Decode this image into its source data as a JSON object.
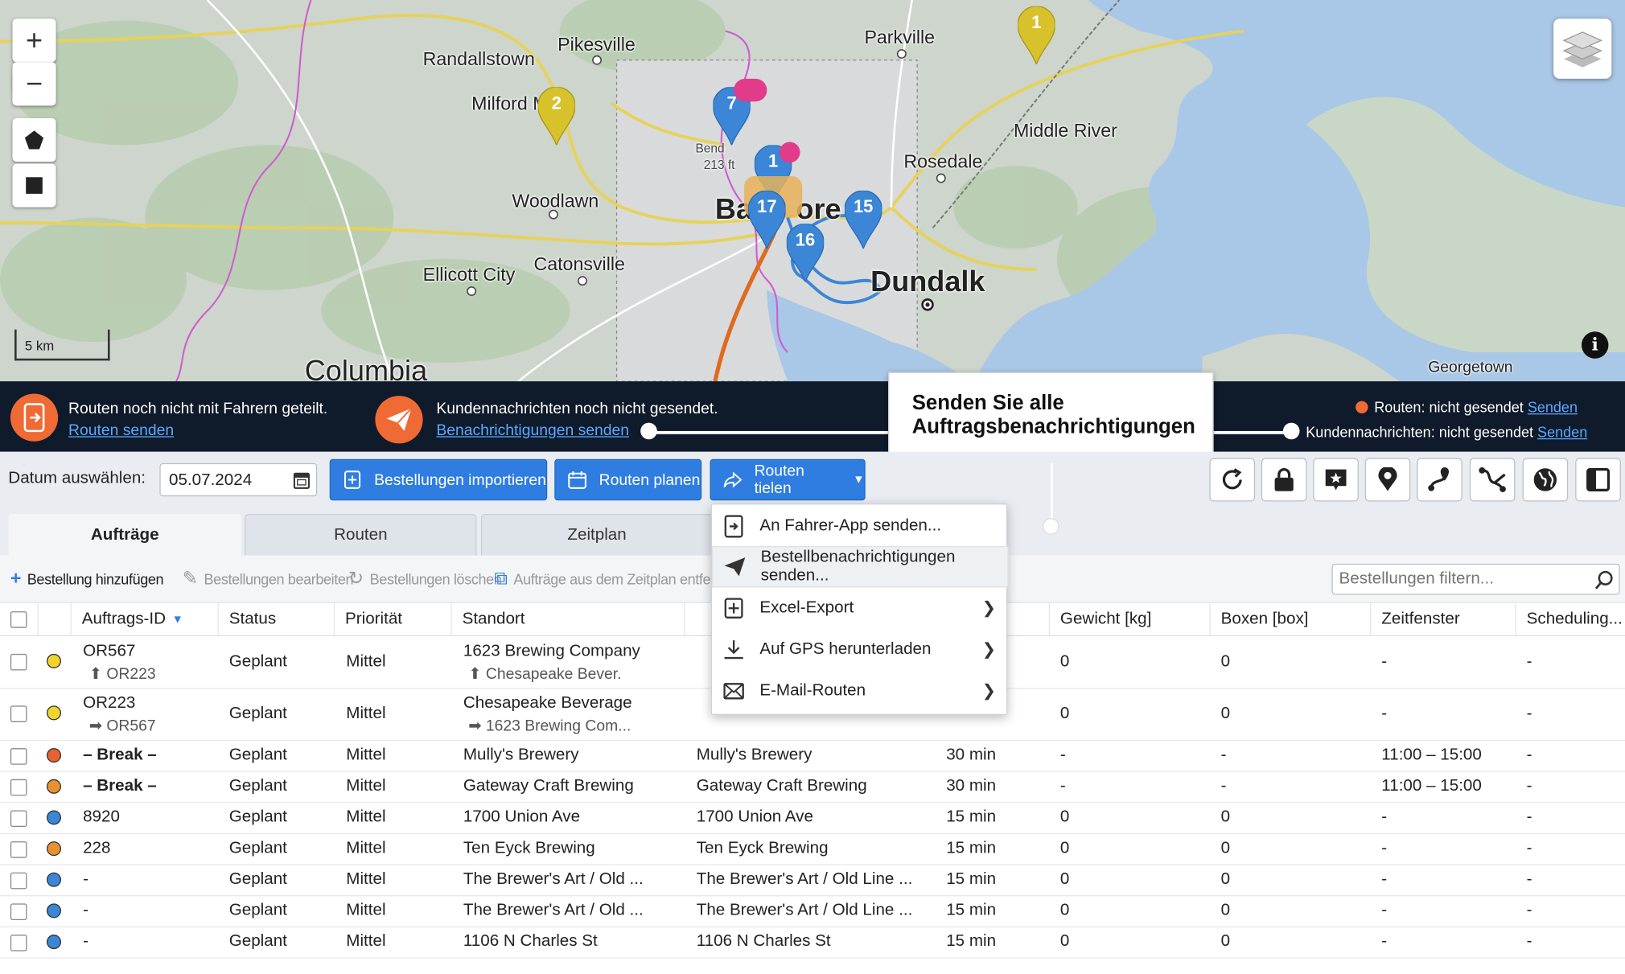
{
  "map": {
    "labels": {
      "randallstown": "Randallstown",
      "pikesville": "Pikesville",
      "parkville": "Parkville",
      "milford": "Milford M",
      "middle_river": "Middle River",
      "rosedale": "Rosedale",
      "woodlawn": "Woodlawn",
      "baltimore_a": "Ba",
      "baltimore_b": "ore",
      "catonsville": "Catonsville",
      "ellicott_city": "Ellicott City",
      "dundalk": "Dundalk",
      "columbia": "Columbia",
      "georgetown": "Georgetown",
      "bend": "Bend",
      "bend_ft": "213 ft"
    },
    "zoom_in": "+",
    "zoom_out": "−",
    "scale": "5 km",
    "info": "i",
    "markers": [
      {
        "label": "1",
        "color": "#d8c22b"
      },
      {
        "label": "2",
        "color": "#d8c22b"
      },
      {
        "label": "7",
        "color": "#3b86d6"
      },
      {
        "label": "1",
        "color": "#3b86d6"
      },
      {
        "label": "17",
        "color": "#3b86d6"
      },
      {
        "label": "16",
        "color": "#3b86d6"
      },
      {
        "label": "15",
        "color": "#3b86d6"
      }
    ]
  },
  "statusbar": {
    "routes_msg": "Routen noch nicht mit Fahrern geteilt.",
    "routes_link": "Routen senden",
    "customer_msg": "Kundennachrichten noch nicht gesendet.",
    "customer_link": "Benachrichtigungen senden",
    "right_routes": "Routen: nicht gesendet",
    "right_routes_link": "Senden",
    "right_customer": "Kundennachrichten: nicht gesendet",
    "right_customer_link": "Senden"
  },
  "callout": {
    "line1": "Senden Sie alle",
    "line2": "Auftragsbenachrichtigungen"
  },
  "toolbar": {
    "date_label": "Datum auswählen:",
    "date_value": "05.07.2024",
    "import_btn": "Bestellungen importieren",
    "plan_btn": "Routen planen",
    "share_btn": "Routen tielen"
  },
  "tabs": [
    "Aufträge",
    "Routen",
    "Zeitplan"
  ],
  "actions": {
    "add": "Bestellung hinzufügen",
    "edit": "Bestellungen bearbeiten",
    "delete": "Bestellungen löschen",
    "remove": "Aufträge aus dem Zeitplan entfernen",
    "filter_placeholder": "Bestellungen filtern..."
  },
  "dropdown": [
    {
      "label": "An Fahrer-App senden...",
      "icon": "phone-send-icon",
      "submenu": false
    },
    {
      "label": "Bestellbenachrichtigungen senden...",
      "icon": "paper-plane-icon",
      "submenu": false
    },
    {
      "label": "Excel-Export",
      "icon": "excel-export-icon",
      "submenu": true
    },
    {
      "label": "Auf GPS herunterladen",
      "icon": "download-icon",
      "submenu": true
    },
    {
      "label": "E-Mail-Routen",
      "icon": "mail-icon",
      "submenu": true
    }
  ],
  "table": {
    "headers": {
      "id": "Auftrags-ID",
      "status": "Status",
      "priority": "Priorität",
      "location": "Standort",
      "weight": "Gewicht [kg]",
      "boxes": "Boxen [box]",
      "timewindow": "Zeitfenster",
      "scheduling": "Scheduling..."
    },
    "rows": [
      {
        "dot": "#f0d42c",
        "id": "OR567",
        "id_sub": "⬆ OR223",
        "status": "Geplant",
        "priority": "Mittel",
        "location": "1623 Brewing Company",
        "location_sub": "⬆ Chesapeake Bever.",
        "address": "",
        "duration": "",
        "weight": "0",
        "boxes": "0",
        "window": "-",
        "sched": "-"
      },
      {
        "dot": "#f0d42c",
        "id": "OR223",
        "id_sub": "➡ OR567",
        "status": "Geplant",
        "priority": "Mittel",
        "location": "Chesapeake Beverage",
        "location_sub": "➡ 1623 Brewing Com...",
        "address": "",
        "duration": "",
        "weight": "0",
        "boxes": "0",
        "window": "-",
        "sched": "-"
      },
      {
        "dot": "#e8622f",
        "id": "– Break –",
        "status": "Geplant",
        "priority": "Mittel",
        "location": "Mully's Brewery",
        "address": "Mully's Brewery",
        "duration": "30 min",
        "weight": "-",
        "boxes": "-",
        "window": "11:00 – 15:00",
        "sched": "-"
      },
      {
        "dot": "#e8922f",
        "id": "– Break –",
        "status": "Geplant",
        "priority": "Mittel",
        "location": "Gateway Craft Brewing",
        "address": "Gateway Craft Brewing",
        "duration": "30 min",
        "weight": "-",
        "boxes": "-",
        "window": "11:00 – 15:00",
        "sched": "-"
      },
      {
        "dot": "#3b86d6",
        "id": "8920",
        "status": "Geplant",
        "priority": "Mittel",
        "location": "1700 Union Ave",
        "address": "1700 Union Ave",
        "duration": "15 min",
        "weight": "0",
        "boxes": "0",
        "window": "-",
        "sched": "-"
      },
      {
        "dot": "#e8922f",
        "id": "228",
        "status": "Geplant",
        "priority": "Mittel",
        "location": "Ten Eyck Brewing",
        "address": "Ten Eyck Brewing",
        "duration": "15 min",
        "weight": "0",
        "boxes": "0",
        "window": "-",
        "sched": "-"
      },
      {
        "dot": "#3b86d6",
        "id": "-",
        "status": "Geplant",
        "priority": "Mittel",
        "location": "The Brewer's Art / Old ...",
        "address": "The Brewer's Art / Old Line ...",
        "duration": "15 min",
        "weight": "0",
        "boxes": "0",
        "window": "-",
        "sched": "-"
      },
      {
        "dot": "#3b86d6",
        "id": "-",
        "status": "Geplant",
        "priority": "Mittel",
        "location": "The Brewer's Art / Old ...",
        "address": "The Brewer's Art / Old Line ...",
        "duration": "15 min",
        "weight": "0",
        "boxes": "0",
        "window": "-",
        "sched": "-"
      },
      {
        "dot": "#3b86d6",
        "id": "-",
        "status": "Geplant",
        "priority": "Mittel",
        "location": "1106 N Charles St",
        "address": "1106 N Charles St",
        "duration": "15 min",
        "weight": "0",
        "boxes": "0",
        "window": "-",
        "sched": "-"
      }
    ]
  }
}
